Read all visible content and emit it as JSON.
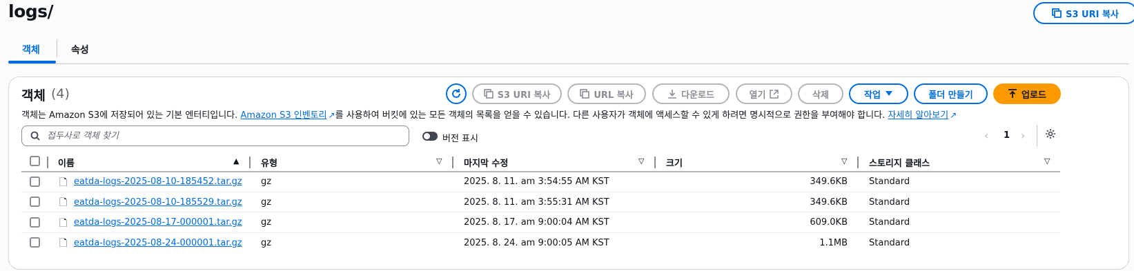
{
  "header": {
    "title": "logs/",
    "copy_uri_label": "S3 URI 복사"
  },
  "tabs": [
    {
      "label": "객체",
      "active": true
    },
    {
      "label": "속성",
      "active": false
    }
  ],
  "objects": {
    "title": "객체",
    "count": "(4)",
    "description_part1": "객체는 Amazon S3에 저장되어 있는 기본 엔터티입니다. ",
    "inventory_link": "Amazon S3 인벤토리",
    "description_part2": "를 사용하여 버킷에 있는 모든 객체의 목록을 얻을 수 있습니다. 다른 사용자가 객체에 액세스할 수 있게 하려면 명시적으로 권한을 부여해야 합니다. ",
    "learn_more_link": "자세히 알아보기",
    "toolbar": {
      "copy_uri": "S3 URI 복사",
      "copy_url": "URL 복사",
      "download": "다운로드",
      "open": "열기",
      "delete": "삭제",
      "actions": "작업",
      "create_folder": "폴더 만들기",
      "upload": "업로드"
    },
    "search_placeholder": "접두사로 객체 찾기",
    "show_versions_label": "버전 표시",
    "page_number": "1",
    "columns": [
      "이름",
      "유형",
      "마지막 수정",
      "크기",
      "스토리지 클래스"
    ],
    "rows": [
      {
        "name": "eatda-logs-2025-08-10-185452.tar.gz",
        "type": "gz",
        "modified": "2025. 8. 11. am 3:54:55 AM KST",
        "size": "349.6KB",
        "storage": "Standard"
      },
      {
        "name": "eatda-logs-2025-08-10-185529.tar.gz",
        "type": "gz",
        "modified": "2025. 8. 11. am 3:55:31 AM KST",
        "size": "349.6KB",
        "storage": "Standard"
      },
      {
        "name": "eatda-logs-2025-08-17-000001.tar.gz",
        "type": "gz",
        "modified": "2025. 8. 17. am 9:00:04 AM KST",
        "size": "609.0KB",
        "storage": "Standard"
      },
      {
        "name": "eatda-logs-2025-08-24-000001.tar.gz",
        "type": "gz",
        "modified": "2025. 8. 24. am 9:00:05 AM KST",
        "size": "1.1MB",
        "storage": "Standard"
      }
    ]
  },
  "colors": {
    "accent": "#006ce0",
    "primary_button": "#ff9900",
    "disabled_border": "#b4b4bb"
  }
}
